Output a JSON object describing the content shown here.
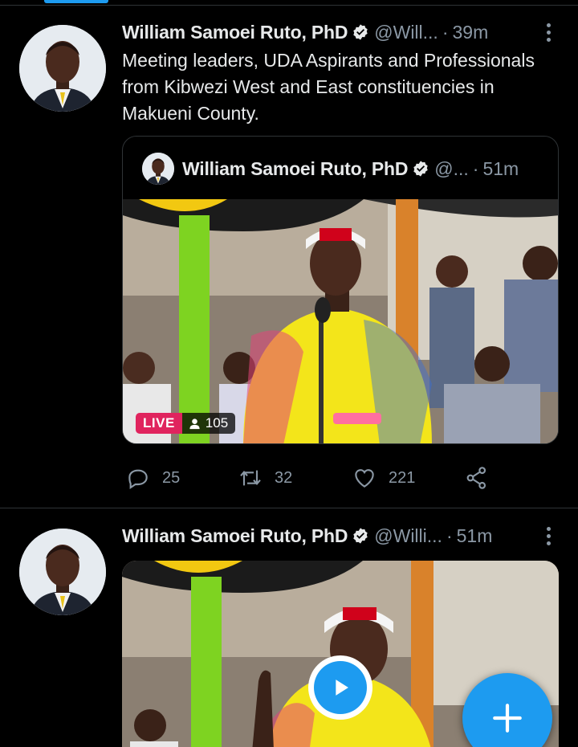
{
  "colors": {
    "accent": "#1d9bf0",
    "live": "#e0245e",
    "muted": "#8b98a5",
    "background": "#000000"
  },
  "tweets": [
    {
      "author": {
        "name": "William Samoei Ruto, PhD",
        "handle": "@Will...",
        "verified": true
      },
      "time": "39m",
      "text": "Meeting leaders, UDA Aspirants and Professionals from Kibwezi West and East constituencies in Makueni County.",
      "quote": {
        "author": {
          "name": "William Samoei Ruto, PhD",
          "handle": "@...",
          "verified": true
        },
        "time": "51m",
        "live_label": "LIVE",
        "viewers": "105"
      },
      "stats": {
        "replies": "25",
        "retweets": "32",
        "likes": "221"
      }
    },
    {
      "author": {
        "name": "William Samoei Ruto, PhD",
        "handle": "@Willi...",
        "verified": true
      },
      "time": "51m"
    }
  ],
  "icons": [
    "verified-badge-icon",
    "more-icon",
    "reply-icon",
    "retweet-icon",
    "like-icon",
    "share-icon",
    "play-icon",
    "compose-plus-icon",
    "viewers-icon"
  ]
}
